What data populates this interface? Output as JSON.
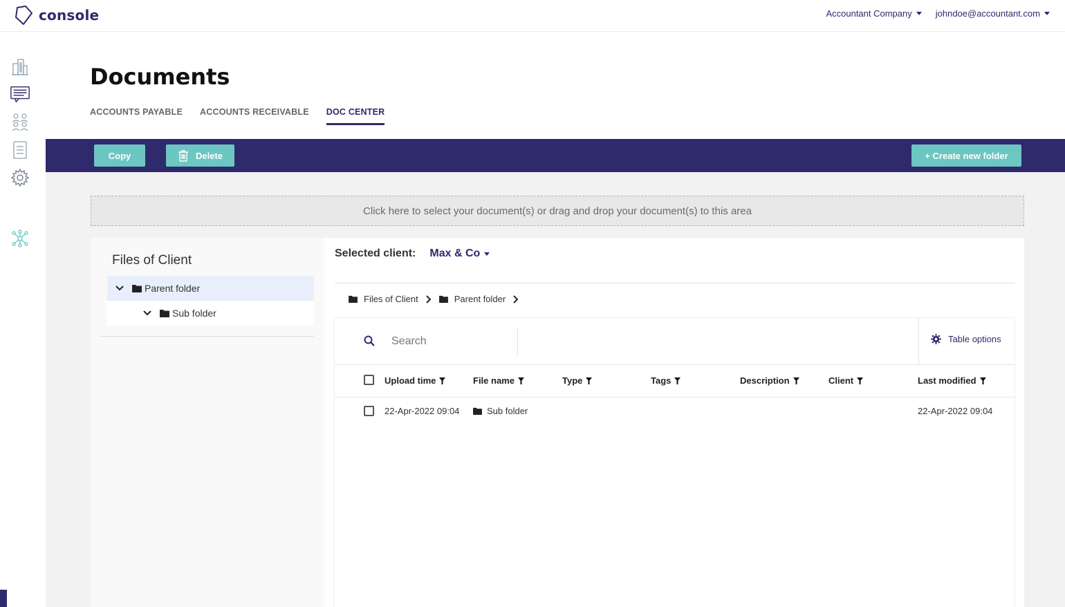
{
  "app": {
    "logo_text": "console"
  },
  "topbar": {
    "company": "Accountant Company",
    "user": "johndoe@accountant.com"
  },
  "sidebar": {
    "icons": [
      "buildings-icon",
      "chat-icon",
      "people-icon",
      "document-list-icon",
      "gear-icon",
      "network-icon"
    ]
  },
  "page": {
    "title": "Documents",
    "tabs": [
      {
        "label": "ACCOUNTS PAYABLE",
        "active": false
      },
      {
        "label": "ACCOUNTS RECEIVABLE",
        "active": false
      },
      {
        "label": "DOC CENTER",
        "active": true
      }
    ]
  },
  "actions": {
    "copy": "Copy",
    "delete": "Delete",
    "create_folder": "+ Create new folder"
  },
  "dropzone": {
    "text": "Click here to select your document(s) or drag and drop your document(s) to this area"
  },
  "tree": {
    "title": "Files of Client",
    "items": [
      {
        "label": "Parent folder",
        "level": 0
      },
      {
        "label": "Sub folder",
        "level": 1
      }
    ]
  },
  "client": {
    "label": "Selected client:",
    "value": "Max & Co"
  },
  "breadcrumb": [
    "Files of Client",
    "Parent folder"
  ],
  "table": {
    "search_placeholder": "Search",
    "options_label": "Table options",
    "columns": [
      "Upload time",
      "File name",
      "Type",
      "Tags",
      "Description",
      "Client",
      "Last modified"
    ],
    "rows": [
      {
        "upload_time": "22-Apr-2022 09:04",
        "file_name": "Sub folder",
        "type": "",
        "tags": "",
        "description": "",
        "client": "",
        "last_modified": "22-Apr-2022 09:04"
      }
    ]
  },
  "colors": {
    "primary": "#2e2a6b",
    "accent": "#6cc6c2",
    "selected_row": "#e8eefb"
  }
}
